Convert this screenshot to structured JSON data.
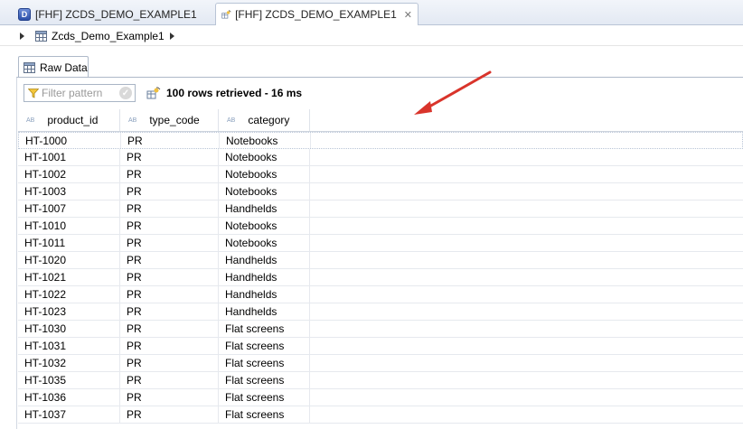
{
  "editor_tabs": [
    {
      "label": "[FHF] ZCDS_DEMO_EXAMPLE1",
      "icon": "ddl-source-icon",
      "active": false
    },
    {
      "label": "[FHF] ZCDS_DEMO_EXAMPLE1",
      "icon": "data-preview-icon",
      "active": true,
      "close": "✕"
    }
  ],
  "breadcrumb": {
    "label": "Zcds_Demo_Example1"
  },
  "view_tab": {
    "label": "Raw Data"
  },
  "toolbar": {
    "filter_placeholder": "Filter pattern",
    "status": "100 rows retrieved - 16 ms"
  },
  "columns": [
    {
      "type_badge": "AB",
      "label": "product_id"
    },
    {
      "type_badge": "AB",
      "label": "type_code"
    },
    {
      "type_badge": "AB",
      "label": "category"
    }
  ],
  "rows": [
    [
      "HT-1000",
      "PR",
      "Notebooks"
    ],
    [
      "HT-1001",
      "PR",
      "Notebooks"
    ],
    [
      "HT-1002",
      "PR",
      "Notebooks"
    ],
    [
      "HT-1003",
      "PR",
      "Notebooks"
    ],
    [
      "HT-1007",
      "PR",
      "Handhelds"
    ],
    [
      "HT-1010",
      "PR",
      "Notebooks"
    ],
    [
      "HT-1011",
      "PR",
      "Notebooks"
    ],
    [
      "HT-1020",
      "PR",
      "Handhelds"
    ],
    [
      "HT-1021",
      "PR",
      "Handhelds"
    ],
    [
      "HT-1022",
      "PR",
      "Handhelds"
    ],
    [
      "HT-1023",
      "PR",
      "Handhelds"
    ],
    [
      "HT-1030",
      "PR",
      "Flat screens"
    ],
    [
      "HT-1031",
      "PR",
      "Flat screens"
    ],
    [
      "HT-1032",
      "PR",
      "Flat screens"
    ],
    [
      "HT-1035",
      "PR",
      "Flat screens"
    ],
    [
      "HT-1036",
      "PR",
      "Flat screens"
    ],
    [
      "HT-1037",
      "PR",
      "Flat screens"
    ]
  ],
  "colors": {
    "annotation_arrow": "#d9342b",
    "tab_border": "#b9c4d6"
  }
}
